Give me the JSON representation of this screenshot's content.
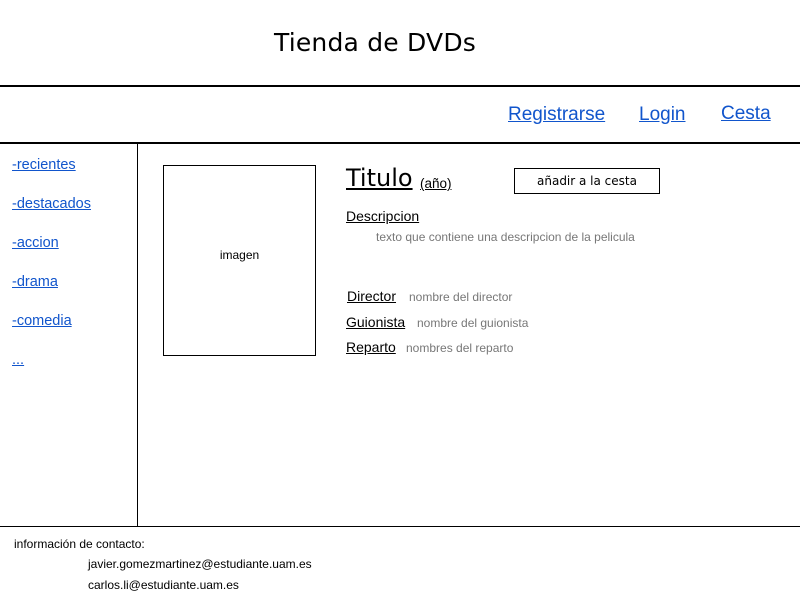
{
  "header": {
    "title": "Tienda de DVDs"
  },
  "nav": {
    "register": "Registrarse",
    "login": "Login",
    "cart": "Cesta"
  },
  "sidebar": {
    "items": [
      {
        "label": "-recientes"
      },
      {
        "label": "-destacados"
      },
      {
        "label": "-accion"
      },
      {
        "label": "-drama"
      },
      {
        "label": "-comedia"
      },
      {
        "label": "..."
      }
    ]
  },
  "movie": {
    "image_label": "imagen",
    "title": "Titulo",
    "year": "(año)",
    "add_to_cart": "añadir a la cesta",
    "description_label": "Descripcion",
    "description_text": "texto que contiene una descripcion de la pelicula",
    "director_label": "Director",
    "director_value": "nombre del director",
    "writer_label": "Guionista",
    "writer_value": "nombre del guionista",
    "cast_label": "Reparto",
    "cast_value": "nombres del reparto"
  },
  "footer": {
    "contact_label": "información de contacto:",
    "emails": [
      "javier.gomezmartinez@estudiante.uam.es",
      "carlos.li@estudiante.uam.es"
    ]
  },
  "colors": {
    "link": "#1155cc",
    "muted_text": "#777777"
  }
}
